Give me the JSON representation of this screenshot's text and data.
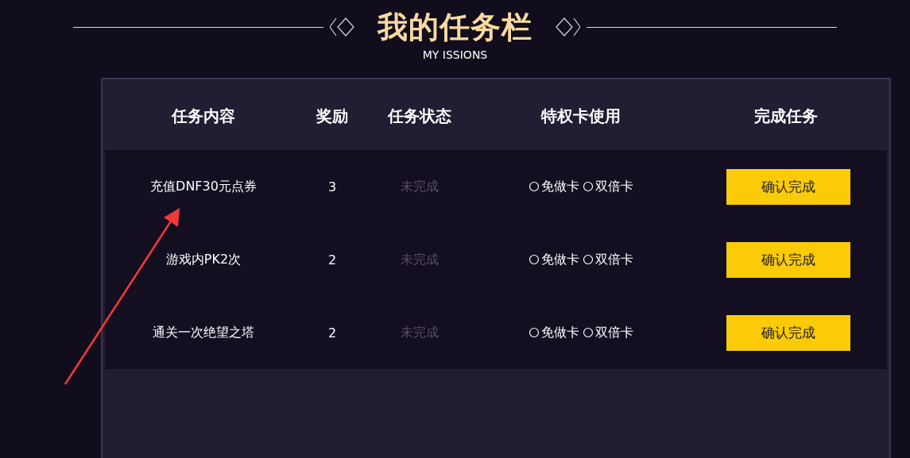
{
  "title": "我的任务栏",
  "subtitle": "MY ISSIONS",
  "table": {
    "columns": [
      "任务内容",
      "奖励",
      "任务状态",
      "特权卡使用",
      "完成任务"
    ],
    "rows": [
      {
        "task": "充值DNF30元点券",
        "reward": "3",
        "status": "未完成",
        "done": false,
        "cards": [
          {
            "label": "免做卡",
            "checked": false
          },
          {
            "label": "双倍卡",
            "checked": false
          }
        ],
        "action": "确认完成"
      },
      {
        "task": "游戏内PK2次",
        "reward": "2",
        "status": "未完成",
        "done": false,
        "cards": [
          {
            "label": "免做卡",
            "checked": false
          },
          {
            "label": "双倍卡",
            "checked": false
          }
        ],
        "action": "确认完成"
      },
      {
        "task": "通关一次绝望之塔",
        "reward": "2",
        "status": "未完成",
        "done": false,
        "cards": [
          {
            "label": "免做卡",
            "checked": false
          },
          {
            "label": "双倍卡",
            "checked": false
          }
        ],
        "action": "确认完成"
      }
    ]
  }
}
